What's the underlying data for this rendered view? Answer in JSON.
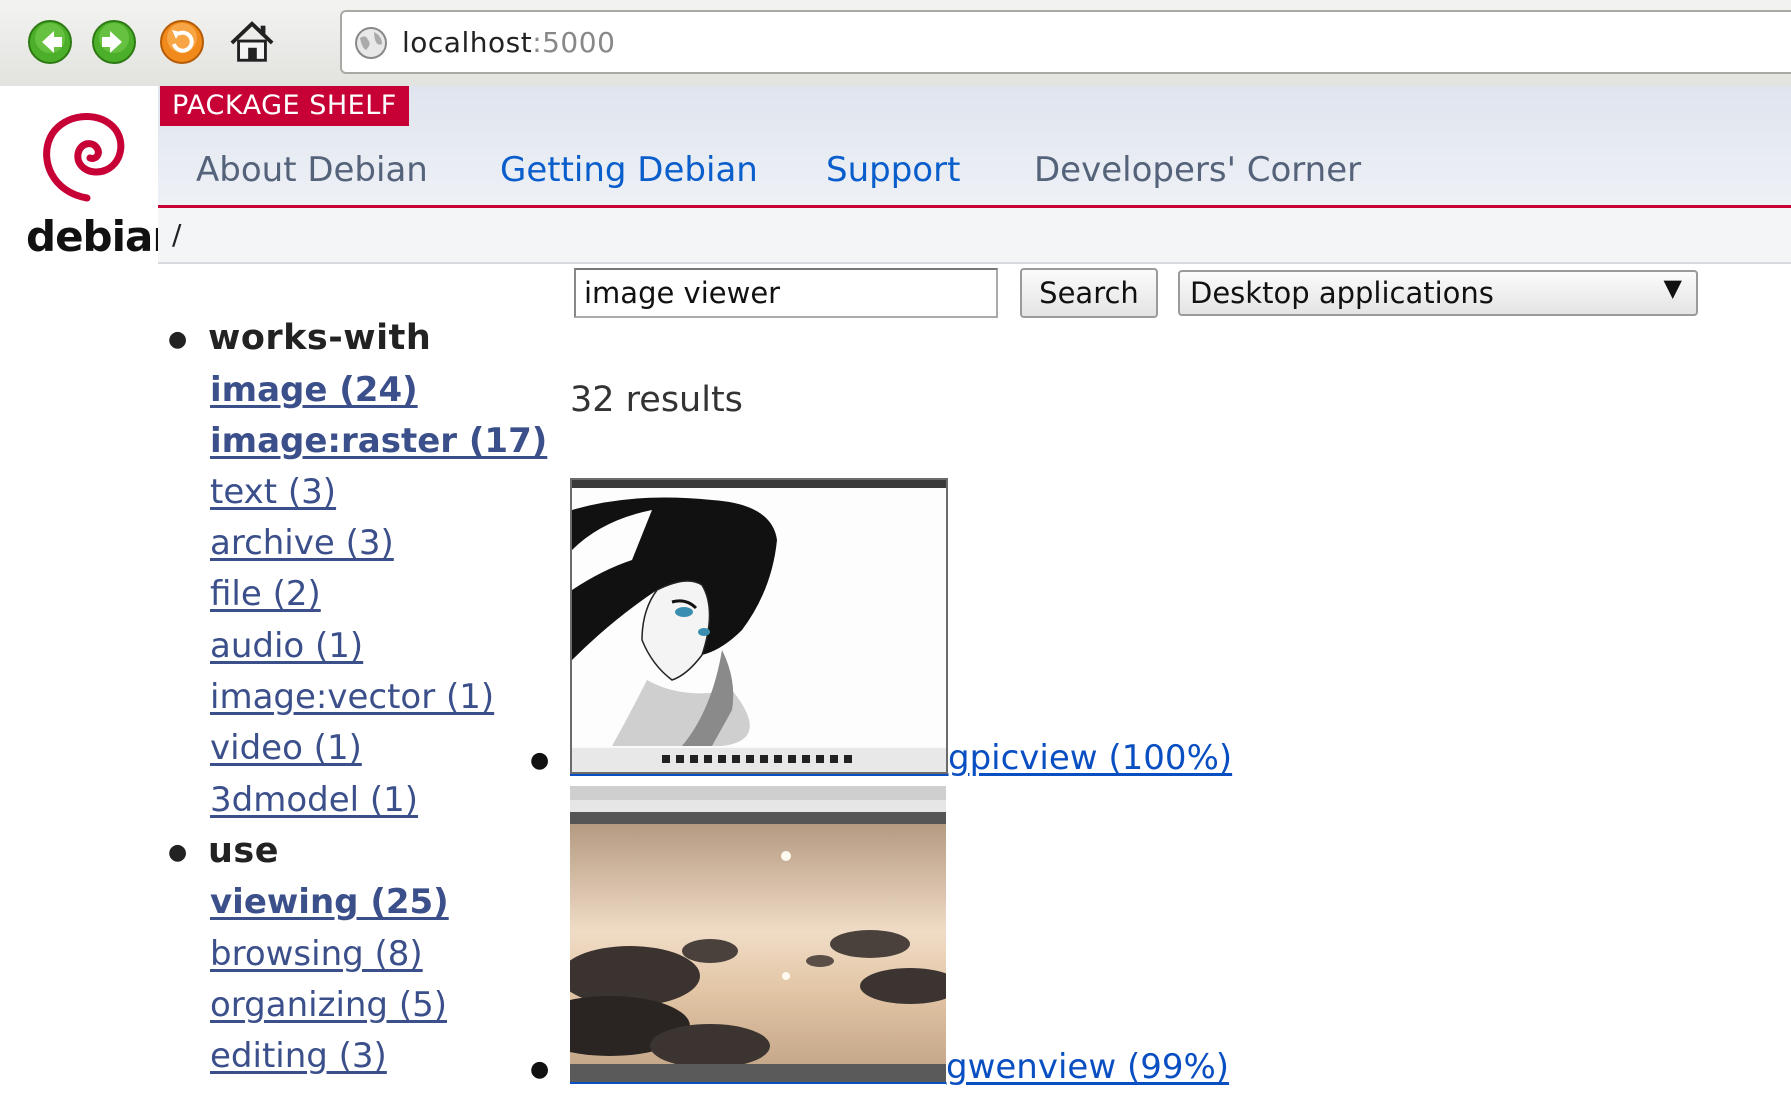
{
  "browser": {
    "url_host": "localhost",
    "url_port": ":5000"
  },
  "header": {
    "logo_text": "debian",
    "section_tag": "PACKAGE SHELF",
    "nav": [
      {
        "label": "About Debian",
        "style": "dim"
      },
      {
        "label": "Getting Debian",
        "style": "blue"
      },
      {
        "label": "Support",
        "style": "blue"
      },
      {
        "label": "Developers' Corner",
        "style": "dim"
      }
    ],
    "breadcrumb": "/"
  },
  "search": {
    "query": "image viewer",
    "button_label": "Search",
    "category_selected": "Desktop applications",
    "dropdown_arrow": "▼"
  },
  "facets": [
    {
      "heading": "works-with",
      "items": [
        {
          "label": "image (24)",
          "bold": true
        },
        {
          "label": "image:raster (17)",
          "bold": true
        },
        {
          "label": "text (3)",
          "bold": false
        },
        {
          "label": "archive (3)",
          "bold": false
        },
        {
          "label": "file (2)",
          "bold": false
        },
        {
          "label": "audio (1)",
          "bold": false
        },
        {
          "label": "image:vector (1)",
          "bold": false
        },
        {
          "label": "video (1)",
          "bold": false
        },
        {
          "label": "3dmodel (1)",
          "bold": false
        }
      ]
    },
    {
      "heading": "use",
      "items": [
        {
          "label": "viewing (25)",
          "bold": true
        },
        {
          "label": "browsing (8)",
          "bold": false
        },
        {
          "label": "organizing (5)",
          "bold": false
        },
        {
          "label": "editing (3)",
          "bold": false
        }
      ]
    }
  ],
  "results": {
    "count_text": "32 results",
    "items": [
      {
        "name": "gpicview (100%)",
        "thumbnail": "anime-portrait-screenshot"
      },
      {
        "name": "gwenview (99%)",
        "thumbnail": "stones-sunset-screenshot"
      }
    ]
  },
  "colors": {
    "debian_red": "#c70036",
    "link_blue": "#0a4fc2",
    "facet_link": "#3b4f8a",
    "nav_dim": "#54627a"
  }
}
